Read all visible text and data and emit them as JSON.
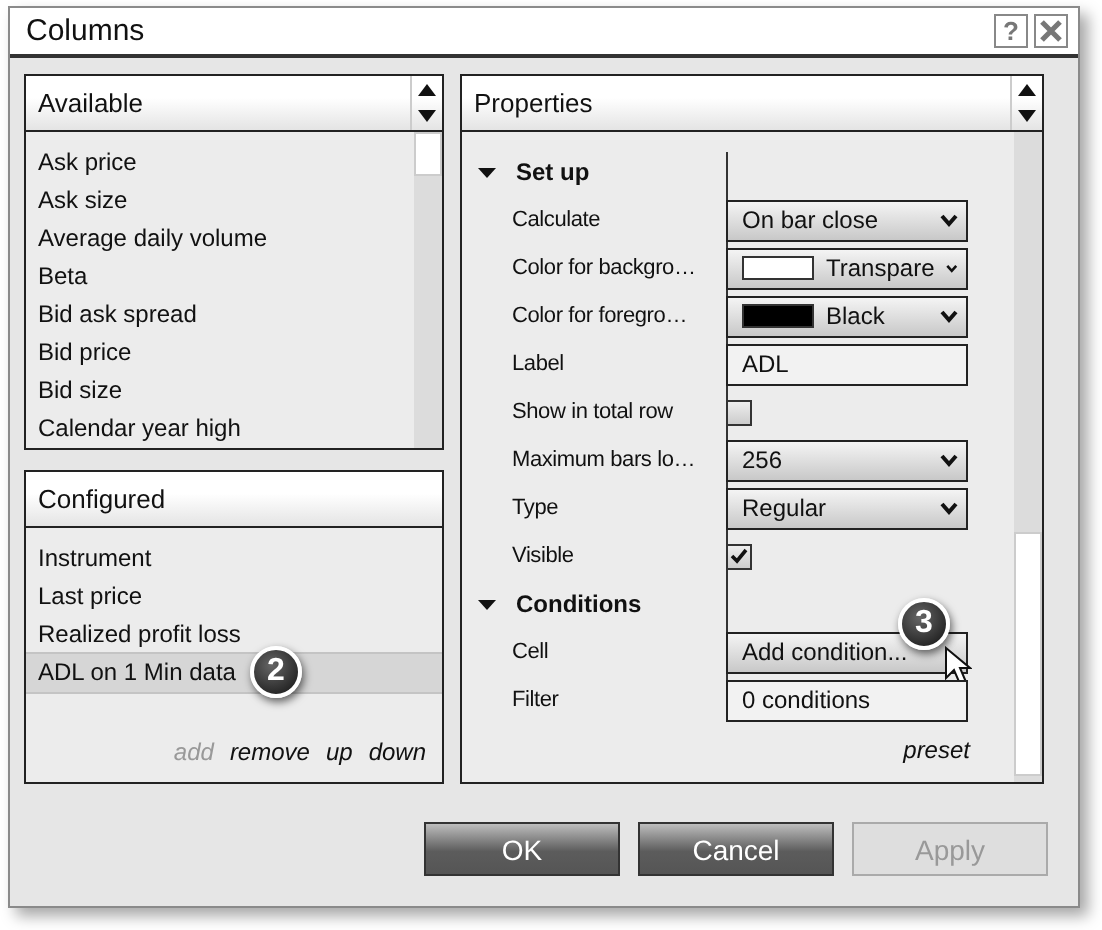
{
  "window": {
    "title": "Columns",
    "help": "?"
  },
  "available": {
    "title": "Available",
    "items": [
      {
        "label": "Ask price",
        "selected": false
      },
      {
        "label": "Ask size",
        "selected": false
      },
      {
        "label": "Average daily volume",
        "selected": false
      },
      {
        "label": "Beta",
        "selected": false
      },
      {
        "label": "Bid ask spread",
        "selected": false
      },
      {
        "label": "Bid price",
        "selected": false
      },
      {
        "label": "Bid size",
        "selected": false
      },
      {
        "label": "Calendar year high",
        "selected": false
      }
    ]
  },
  "configured": {
    "title": "Configured",
    "items": [
      {
        "label": "Instrument",
        "selected": false
      },
      {
        "label": "Last price",
        "selected": false
      },
      {
        "label": "Realized profit loss",
        "selected": false
      },
      {
        "label": "ADL on 1 Min data",
        "selected": true,
        "callout": "2"
      }
    ],
    "actions": [
      {
        "label": "add",
        "disabled": true
      },
      {
        "label": "remove",
        "disabled": false
      },
      {
        "label": "up",
        "disabled": false
      },
      {
        "label": "down",
        "disabled": false
      }
    ]
  },
  "properties": {
    "title": "Properties",
    "groups": [
      {
        "label": "Set up",
        "expanded": true,
        "rows": [
          {
            "label": "Calculate",
            "kind": "dropdown",
            "value": "On bar close"
          },
          {
            "label": "Color for backgro…",
            "kind": "color",
            "value": "Transpare",
            "color": "#ffffff"
          },
          {
            "label": "Color for foregro…",
            "kind": "color",
            "value": "Black",
            "color": "#000000"
          },
          {
            "label": "Label",
            "kind": "text",
            "value": "ADL"
          },
          {
            "label": "Show in total row",
            "kind": "checkbox",
            "checked": false
          },
          {
            "label": "Maximum bars lo…",
            "kind": "dropdown",
            "value": "256"
          },
          {
            "label": "Type",
            "kind": "dropdown",
            "value": "Regular"
          },
          {
            "label": "Visible",
            "kind": "checkbox",
            "checked": true
          }
        ]
      },
      {
        "label": "Conditions",
        "expanded": true,
        "rows": [
          {
            "label": "Cell",
            "kind": "button",
            "value": "Add condition...",
            "callout": "3"
          },
          {
            "label": "Filter",
            "kind": "text",
            "value": "0 conditions"
          }
        ]
      }
    ],
    "preset": "preset"
  },
  "buttons": [
    {
      "label": "OK",
      "disabled": false
    },
    {
      "label": "Cancel",
      "disabled": false
    },
    {
      "label": "Apply",
      "disabled": true
    }
  ]
}
